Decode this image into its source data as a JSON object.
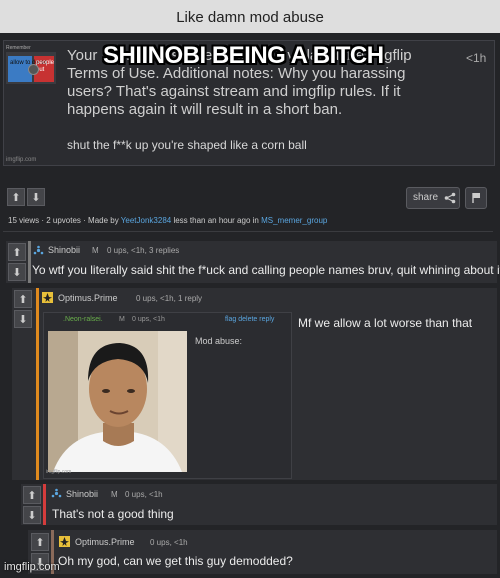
{
  "title": "Like damn mod abuse",
  "meme_caption": "SHIINOBI BEING A BITCH",
  "notice": {
    "text": "Your … … …ause they believe it violated the imgflip Terms of Use. Additional notes: Why you harassing users? That's against stream and imgflip rules. If it happens again it will result in a short ban.",
    "time": "<1h",
    "reply": "shut the f**k up you're shaped like a corn ball",
    "watermark": "imgflip.com",
    "thumb_label": "Remember",
    "thumb_left": "allow to do so",
    "thumb_right": "people out"
  },
  "post": {
    "share_label": "share",
    "stats_prefix": "15 views · 2 upvotes · Made by",
    "author": "YeetJonk3284",
    "stats_mid": "less than an hour ago in",
    "stream": "MS_memer_group"
  },
  "comments": [
    {
      "user": "Shinobii",
      "badge": "M",
      "meta": "0 ups, <1h, 3 replies",
      "text": "Yo wtf you literally said shit the f*uck and calling people names bruv, quit whining about it"
    },
    {
      "user": "Optimus.Prime",
      "meta": "0 ups, <1h, 1 reply",
      "text": "Mf we allow a lot worse than that"
    },
    {
      "user": "Shinobii",
      "badge": "M",
      "meta": "0 ups, <1h",
      "text": "That's not a good thing"
    },
    {
      "user": "Optimus.Prime",
      "meta": "0 ups, <1h",
      "text": "Oh my god, can we get this guy demodded?"
    }
  ],
  "inner": {
    "user": ".Neon-ralsei.",
    "badge": "M",
    "meta": "0 ups, <1h",
    "links": "flag delete reply",
    "text": "Mod abuse:",
    "watermark": "imgflip.com"
  },
  "watermark": "imgflip.com",
  "colors": {
    "strip_gray": "#7a7a7a",
    "strip_orange": "#e08a1e",
    "strip_red": "#d43c3c",
    "strip_brown": "#8a6a5a",
    "link": "#5aa6e0"
  }
}
